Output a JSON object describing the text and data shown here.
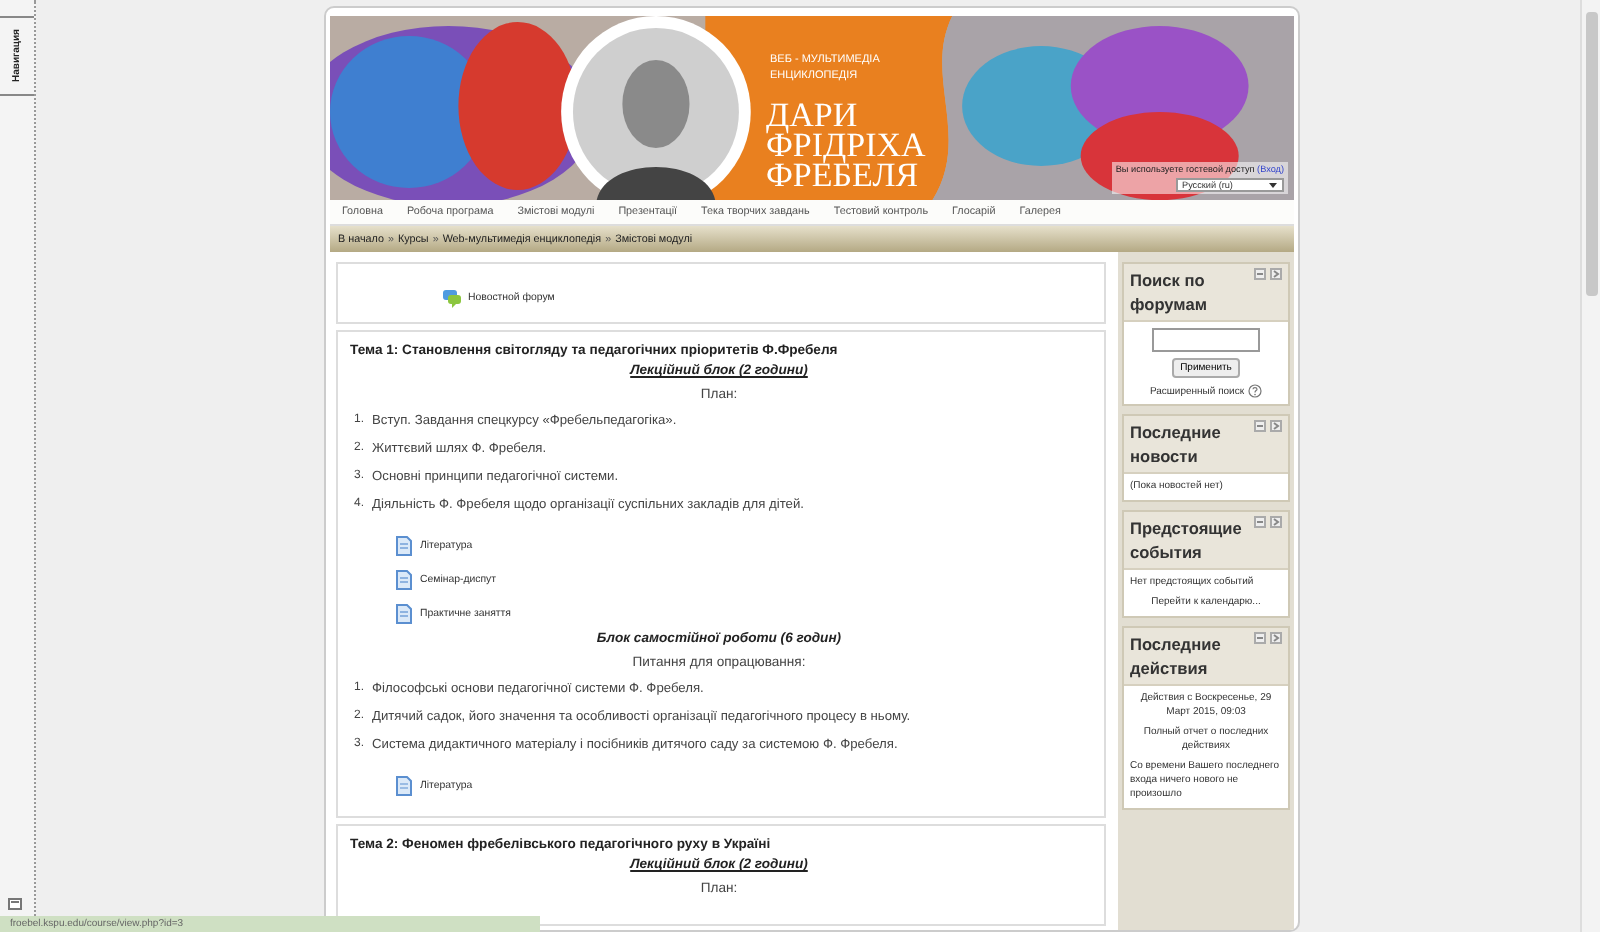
{
  "side_panel": {
    "tab": "Навигация"
  },
  "header": {
    "subtitle": [
      "ВЕБ - МУЛЬТИМЕДІА",
      "ЕНЦИКЛОПЕДІЯ"
    ],
    "title": [
      "ДАРИ",
      "ФРІДРІХА",
      "ФРЕБЕЛЯ"
    ],
    "login_info": "Вы используете гостевой доступ",
    "login_link": "(Вход)",
    "language": "Русский (ru)"
  },
  "nav": [
    "Головна",
    "Робоча програма",
    "Змістові модулі",
    "Презентації",
    "Тека творчих завдань",
    "Тестовий контроль",
    "Глосарій",
    "Галерея"
  ],
  "breadcrumb": {
    "separator": "»",
    "items": [
      "В начало",
      "Курсы",
      "Web-мультимедія енциклопедія",
      "Змістові модулі"
    ]
  },
  "sections": [
    {
      "items": [
        {
          "kind": "forum",
          "text": "Новостной форум"
        }
      ]
    },
    {
      "items": [
        {
          "kind": "heading",
          "text": "Тема 1: Становлення світогляду та педагогічних пріоритетів Ф.Фребеля"
        },
        {
          "kind": "subheading",
          "text": "Лекційний блок (2 години)"
        },
        {
          "kind": "caption",
          "text": "План:"
        },
        {
          "kind": "numbered",
          "number": "1.",
          "text": "Вступ. Завдання спецкурсу «Фребельпедагогіка»."
        },
        {
          "kind": "numbered",
          "number": "2.",
          "text": "Життєвий шлях Ф. Фребеля."
        },
        {
          "kind": "numbered",
          "number": "3.",
          "text": "Основні принципи педагогічної системи."
        },
        {
          "kind": "numbered",
          "number": "4.",
          "text": "Діяльність Ф. Фребеля щодо організації суспільних закладів для дітей."
        },
        {
          "kind": "resource",
          "text": "Література"
        },
        {
          "kind": "resource",
          "text": "Семінар-диспут"
        },
        {
          "kind": "resource",
          "text": "Практичне заняття"
        },
        {
          "kind": "plainheading",
          "text": "Блок самостійної роботи (6 годин)"
        },
        {
          "kind": "caption",
          "text": "Питання для опрацювання:"
        },
        {
          "kind": "numbered",
          "number": "1.",
          "text": "Філософські основи педагогічної системи Ф. Фребеля."
        },
        {
          "kind": "numbered",
          "number": "2.",
          "text": "Дитячий садок, його значення та особливості організації педагогічного процесу в ньому."
        },
        {
          "kind": "numbered",
          "number": "3.",
          "text": "Система дидактичного матеріалу і посібників дитячого саду за системою Ф. Фребеля."
        },
        {
          "kind": "resource",
          "text": "Література"
        }
      ]
    },
    {
      "items": [
        {
          "kind": "heading",
          "text": "Тема 2: Феномен фребелівського педагогічного руху в Україні"
        },
        {
          "kind": "subheading",
          "text": "Лекційний блок (2 години)"
        },
        {
          "kind": "caption",
          "text": "План:"
        }
      ]
    }
  ],
  "blocks": [
    {
      "title": "Поиск по форумам",
      "content": [
        {
          "kind": "search",
          "button": "Применить",
          "link": "Расширенный поиск"
        }
      ]
    },
    {
      "title": "Последние новости",
      "content": [
        {
          "kind": "text",
          "text": "(Пока новостей нет)"
        }
      ]
    },
    {
      "title": "Предстоящие события",
      "content": [
        {
          "kind": "text",
          "text": "Нет предстоящих событий"
        },
        {
          "kind": "link",
          "text": "Перейти к календарю..."
        }
      ]
    },
    {
      "title": "Последние действия",
      "content": [
        {
          "kind": "center",
          "text": "Действия с Воскресенье, 29 Март 2015, 09:03"
        },
        {
          "kind": "link",
          "text": "Полный отчет о последних действиях"
        },
        {
          "kind": "text",
          "text": "Со времени Вашего последнего входа ничего нового не произошло"
        }
      ]
    }
  ],
  "status_bar": {
    "url": "froebel.kspu.edu/course/view.php?id=3"
  }
}
